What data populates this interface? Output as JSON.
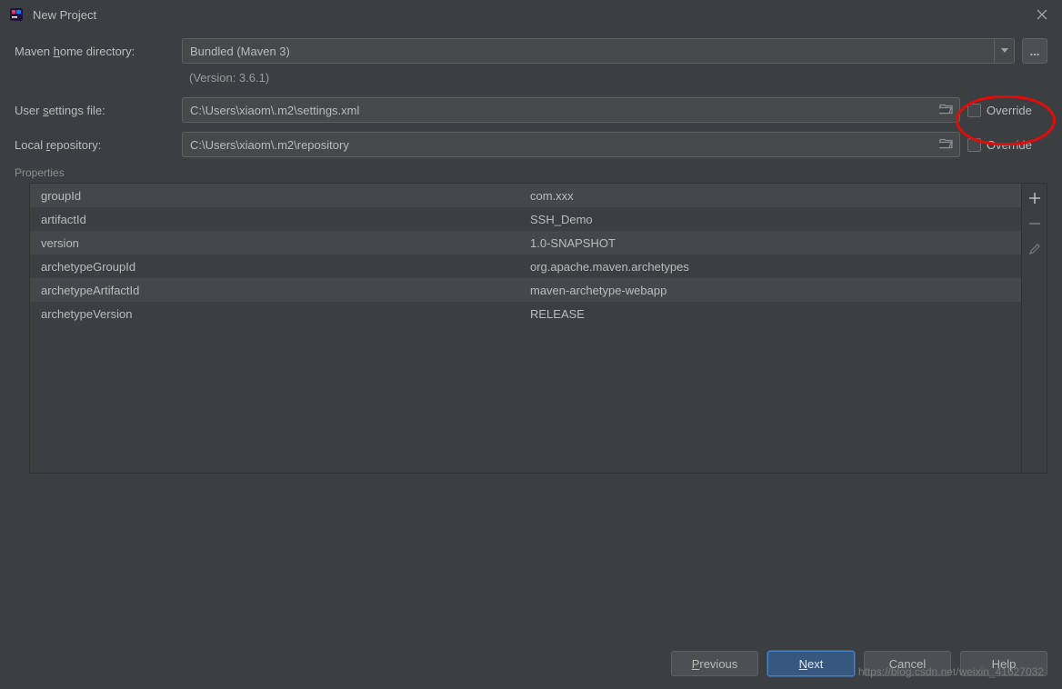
{
  "window": {
    "title": "New Project"
  },
  "labels": {
    "maven_home_pre": "Maven ",
    "maven_home_mn": "h",
    "maven_home_post": "ome directory:",
    "user_settings_pre": "User ",
    "user_settings_mn": "s",
    "user_settings_post": "ettings file:",
    "local_repo_pre": "Local ",
    "local_repo_mn": "r",
    "local_repo_post": "epository:",
    "properties": "Properties",
    "override": "Override"
  },
  "fields": {
    "maven_home": "Bundled (Maven 3)",
    "version": "(Version: 3.6.1)",
    "user_settings": "C:\\Users\\xiaom\\.m2\\settings.xml",
    "local_repo": "C:\\Users\\xiaom\\.m2\\repository",
    "ellipsis": "..."
  },
  "properties": [
    {
      "key": "groupId",
      "value": "com.xxx"
    },
    {
      "key": "artifactId",
      "value": "SSH_Demo"
    },
    {
      "key": "version",
      "value": "1.0-SNAPSHOT"
    },
    {
      "key": "archetypeGroupId",
      "value": "org.apache.maven.archetypes"
    },
    {
      "key": "archetypeArtifactId",
      "value": "maven-archetype-webapp"
    },
    {
      "key": "archetypeVersion",
      "value": "RELEASE"
    }
  ],
  "buttons": {
    "previous_mn": "P",
    "previous_rest": "revious",
    "next_mn": "N",
    "next_rest": "ext",
    "cancel": "Cancel",
    "help": "Help"
  },
  "watermark": "https://blog.csdn.net/weixin_41627032"
}
